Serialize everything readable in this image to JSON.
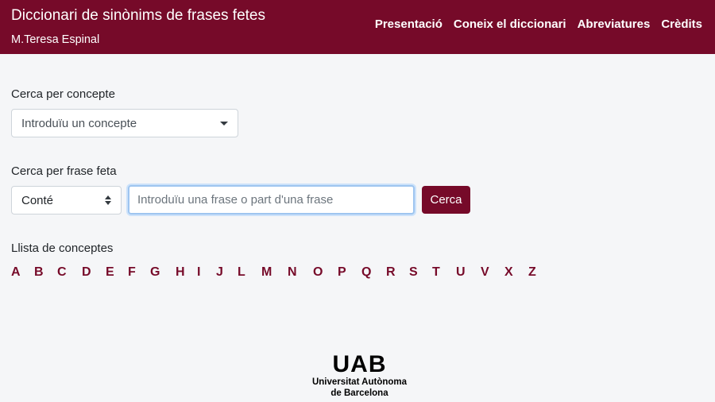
{
  "header": {
    "title": "Diccionari de sinònims de frases fetes",
    "subtitle": "M.Teresa Espinal",
    "nav": [
      "Presentació",
      "Coneix el diccionari",
      "Abreviatures",
      "Crèdits"
    ]
  },
  "concept_search": {
    "label": "Cerca per concepte",
    "placeholder": "Introduïu un concepte"
  },
  "phrase_search": {
    "label": "Cerca per frase feta",
    "mode_value": "Conté",
    "input_placeholder": "Introduïu una frase o part d'una frase",
    "button_label": "Cerca"
  },
  "concept_list": {
    "label": "Llista de conceptes",
    "letters": [
      "A",
      "B",
      "C",
      "D",
      "E",
      "F",
      "G",
      "H",
      "I",
      "J",
      "L",
      "M",
      "N",
      "O",
      "P",
      "Q",
      "R",
      "S",
      "T",
      "U",
      "V",
      "X",
      "Z"
    ]
  },
  "footer": {
    "logo_mark": "UAB",
    "logo_line1": "Universitat Autònoma",
    "logo_line2": "de Barcelona"
  },
  "colors": {
    "brand": "#760a29",
    "background": "#f5f6f8"
  }
}
